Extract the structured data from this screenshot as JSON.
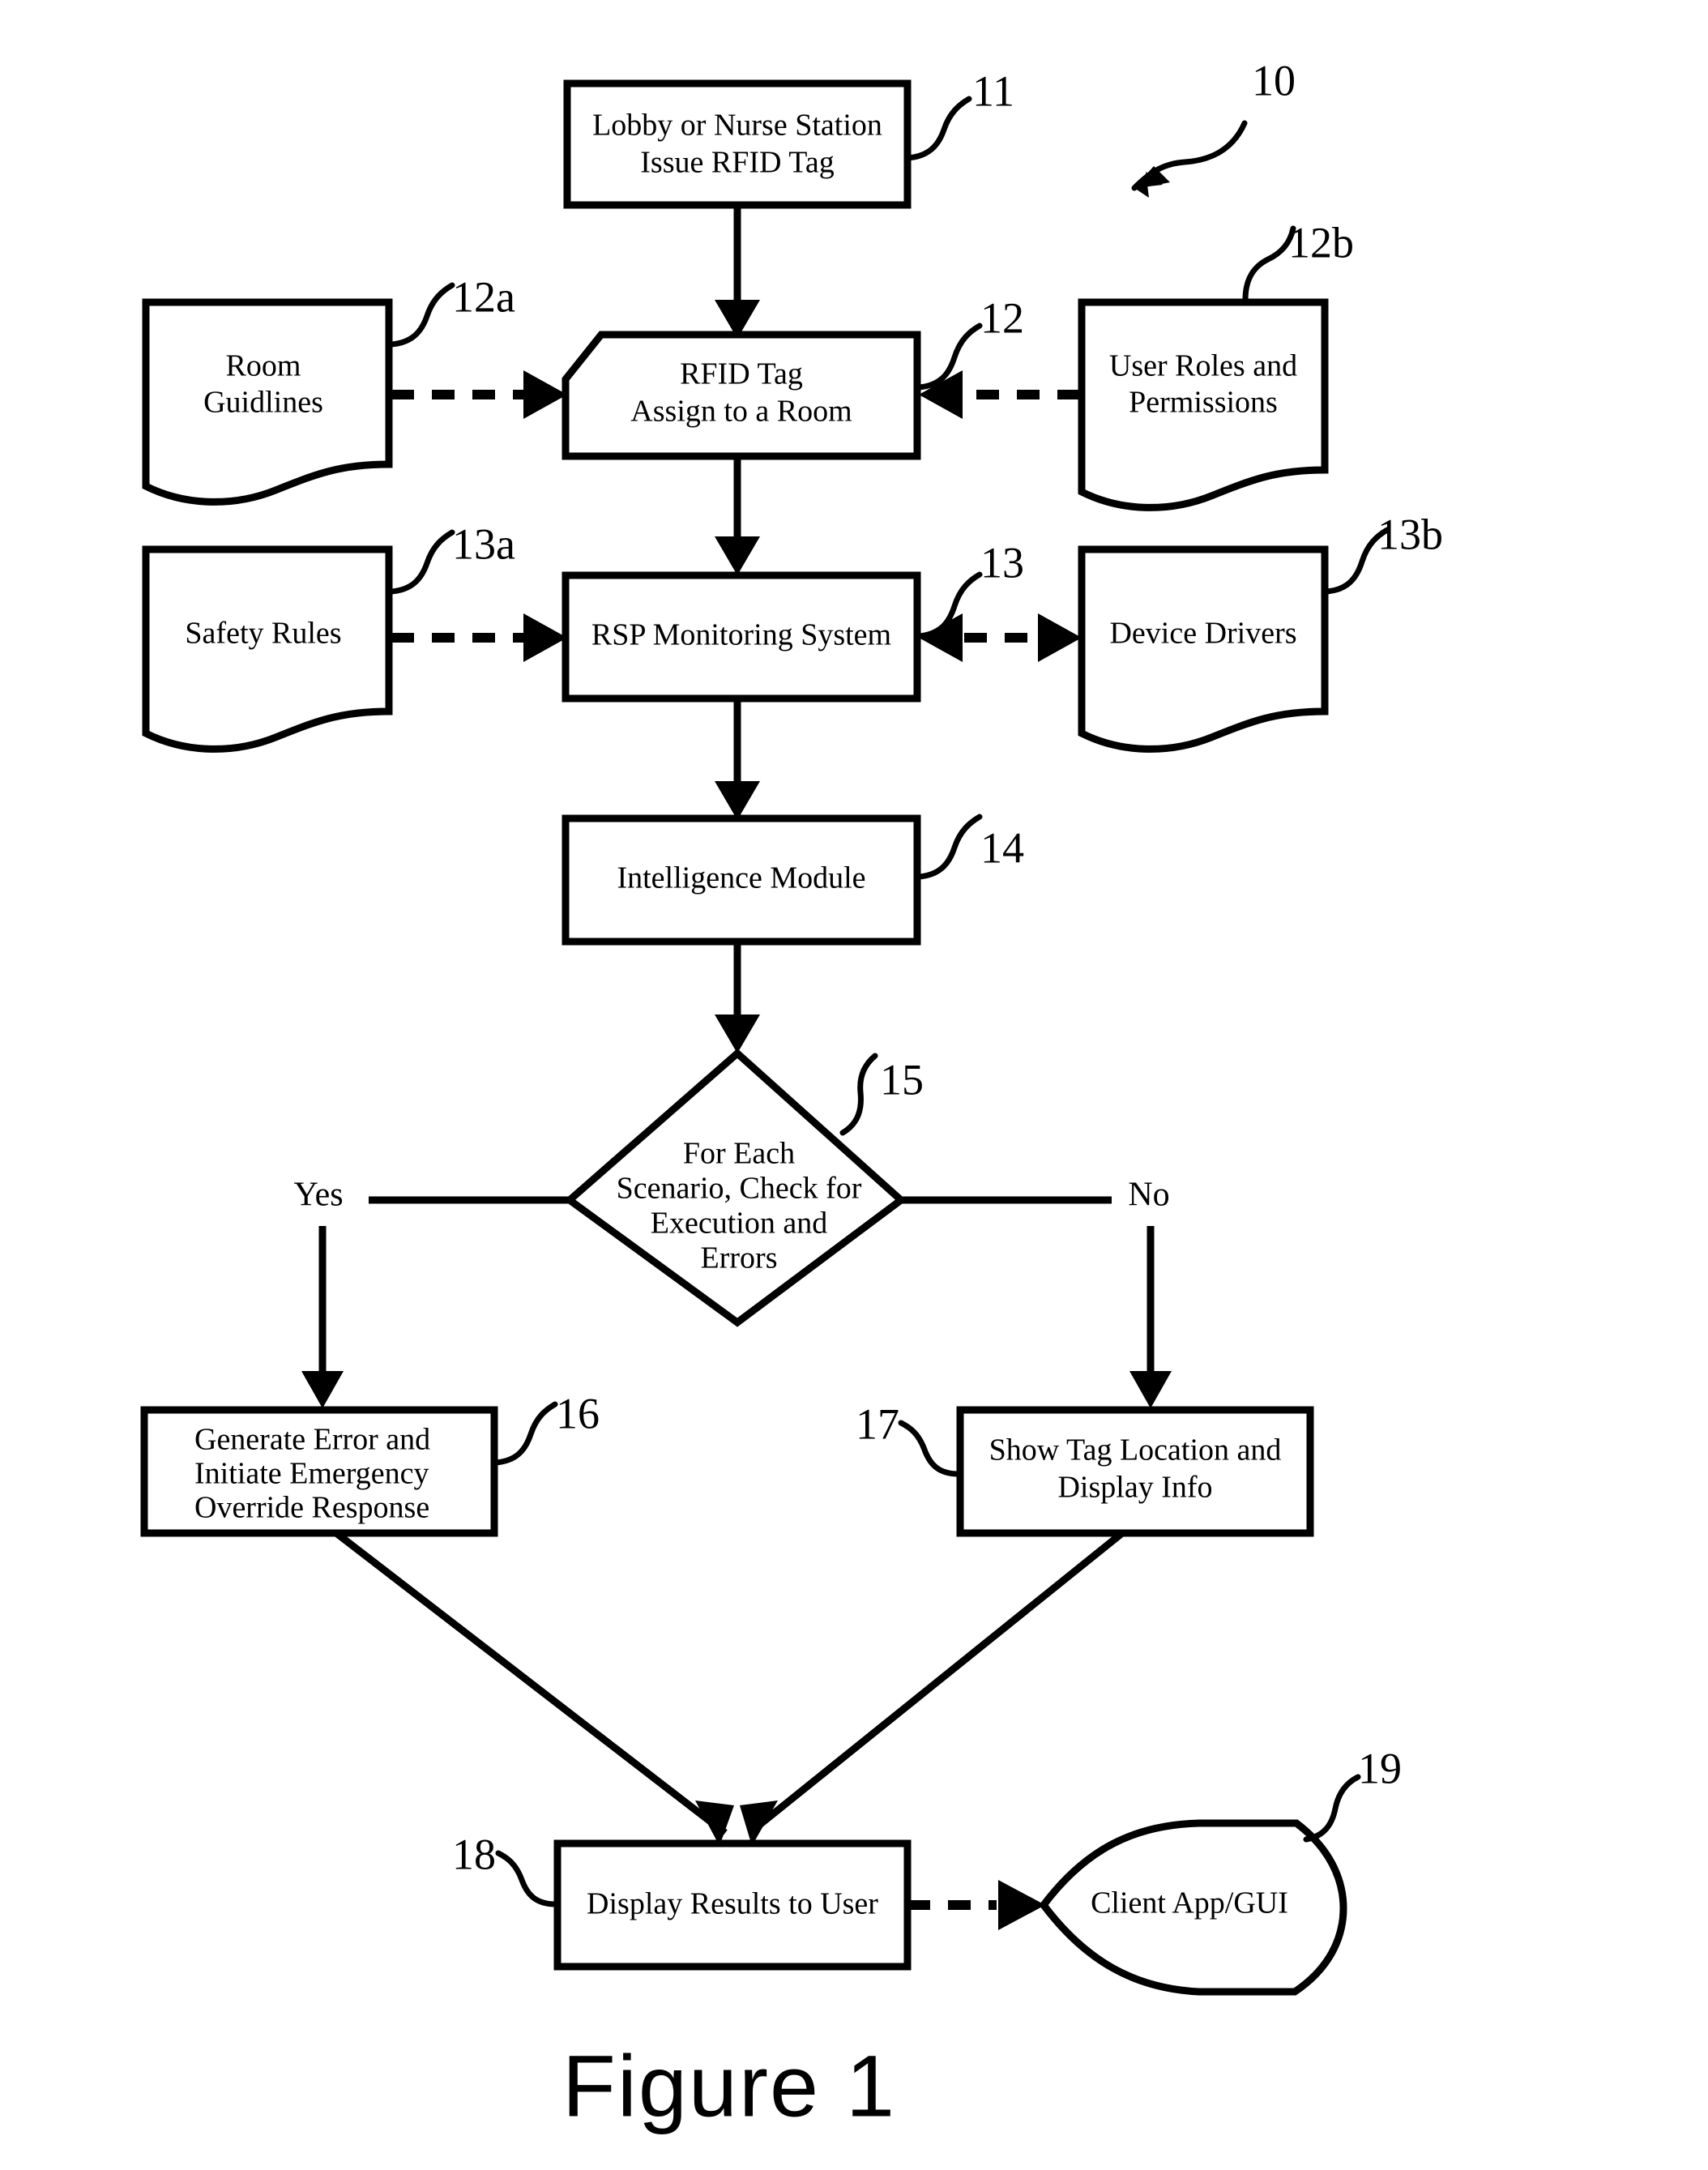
{
  "figure": {
    "caption": "Figure 1",
    "system_ref": "10"
  },
  "nodes": {
    "lobby": {
      "ref": "11",
      "line1": "Lobby or Nurse Station",
      "line2": "Issue RFID Tag",
      "shape": "rectangle"
    },
    "room_guidelines": {
      "ref": "12a",
      "line1": "Room",
      "line2": "Guidlines",
      "shape": "document"
    },
    "rfid_tag": {
      "ref": "12",
      "line1": "RFID Tag",
      "line2": "Assign to a Room",
      "shape": "bevelled-rectangle"
    },
    "user_roles": {
      "ref": "12b",
      "line1": "User Roles and",
      "line2": "Permissions",
      "shape": "document"
    },
    "safety_rules": {
      "ref": "13a",
      "line1": "Safety Rules",
      "line2": "",
      "shape": "document"
    },
    "rsp_monitoring": {
      "ref": "13",
      "line1": "RSP Monitoring System",
      "line2": "",
      "shape": "rectangle"
    },
    "device_drivers": {
      "ref": "13b",
      "line1": "Device Drivers",
      "line2": "",
      "shape": "document"
    },
    "intelligence_module": {
      "ref": "14",
      "line1": "Intelligence Module",
      "line2": "",
      "shape": "rectangle"
    },
    "decision": {
      "ref": "15",
      "line1": "For Each",
      "line2": "Scenario, Check for",
      "line3": "Execution and",
      "line4": "Errors",
      "shape": "diamond"
    },
    "generate_error": {
      "ref": "16",
      "line1": "Generate Error and",
      "line2": "Initiate Emergency",
      "line3": "Override Response",
      "shape": "rectangle"
    },
    "show_tag": {
      "ref": "17",
      "line1": "Show Tag Location and",
      "line2": "Display Info",
      "shape": "rectangle"
    },
    "display_results": {
      "ref": "18",
      "line1": "Display Results to User",
      "line2": "",
      "shape": "rectangle"
    },
    "client_app": {
      "ref": "19",
      "line1": "Client App/GUI",
      "line2": "",
      "shape": "leaf"
    }
  },
  "branches": {
    "yes_label": "Yes",
    "no_label": "No"
  },
  "style": {
    "stroke_color": "#000000",
    "fill_color": "#ffffff",
    "background": "#ffffff"
  }
}
